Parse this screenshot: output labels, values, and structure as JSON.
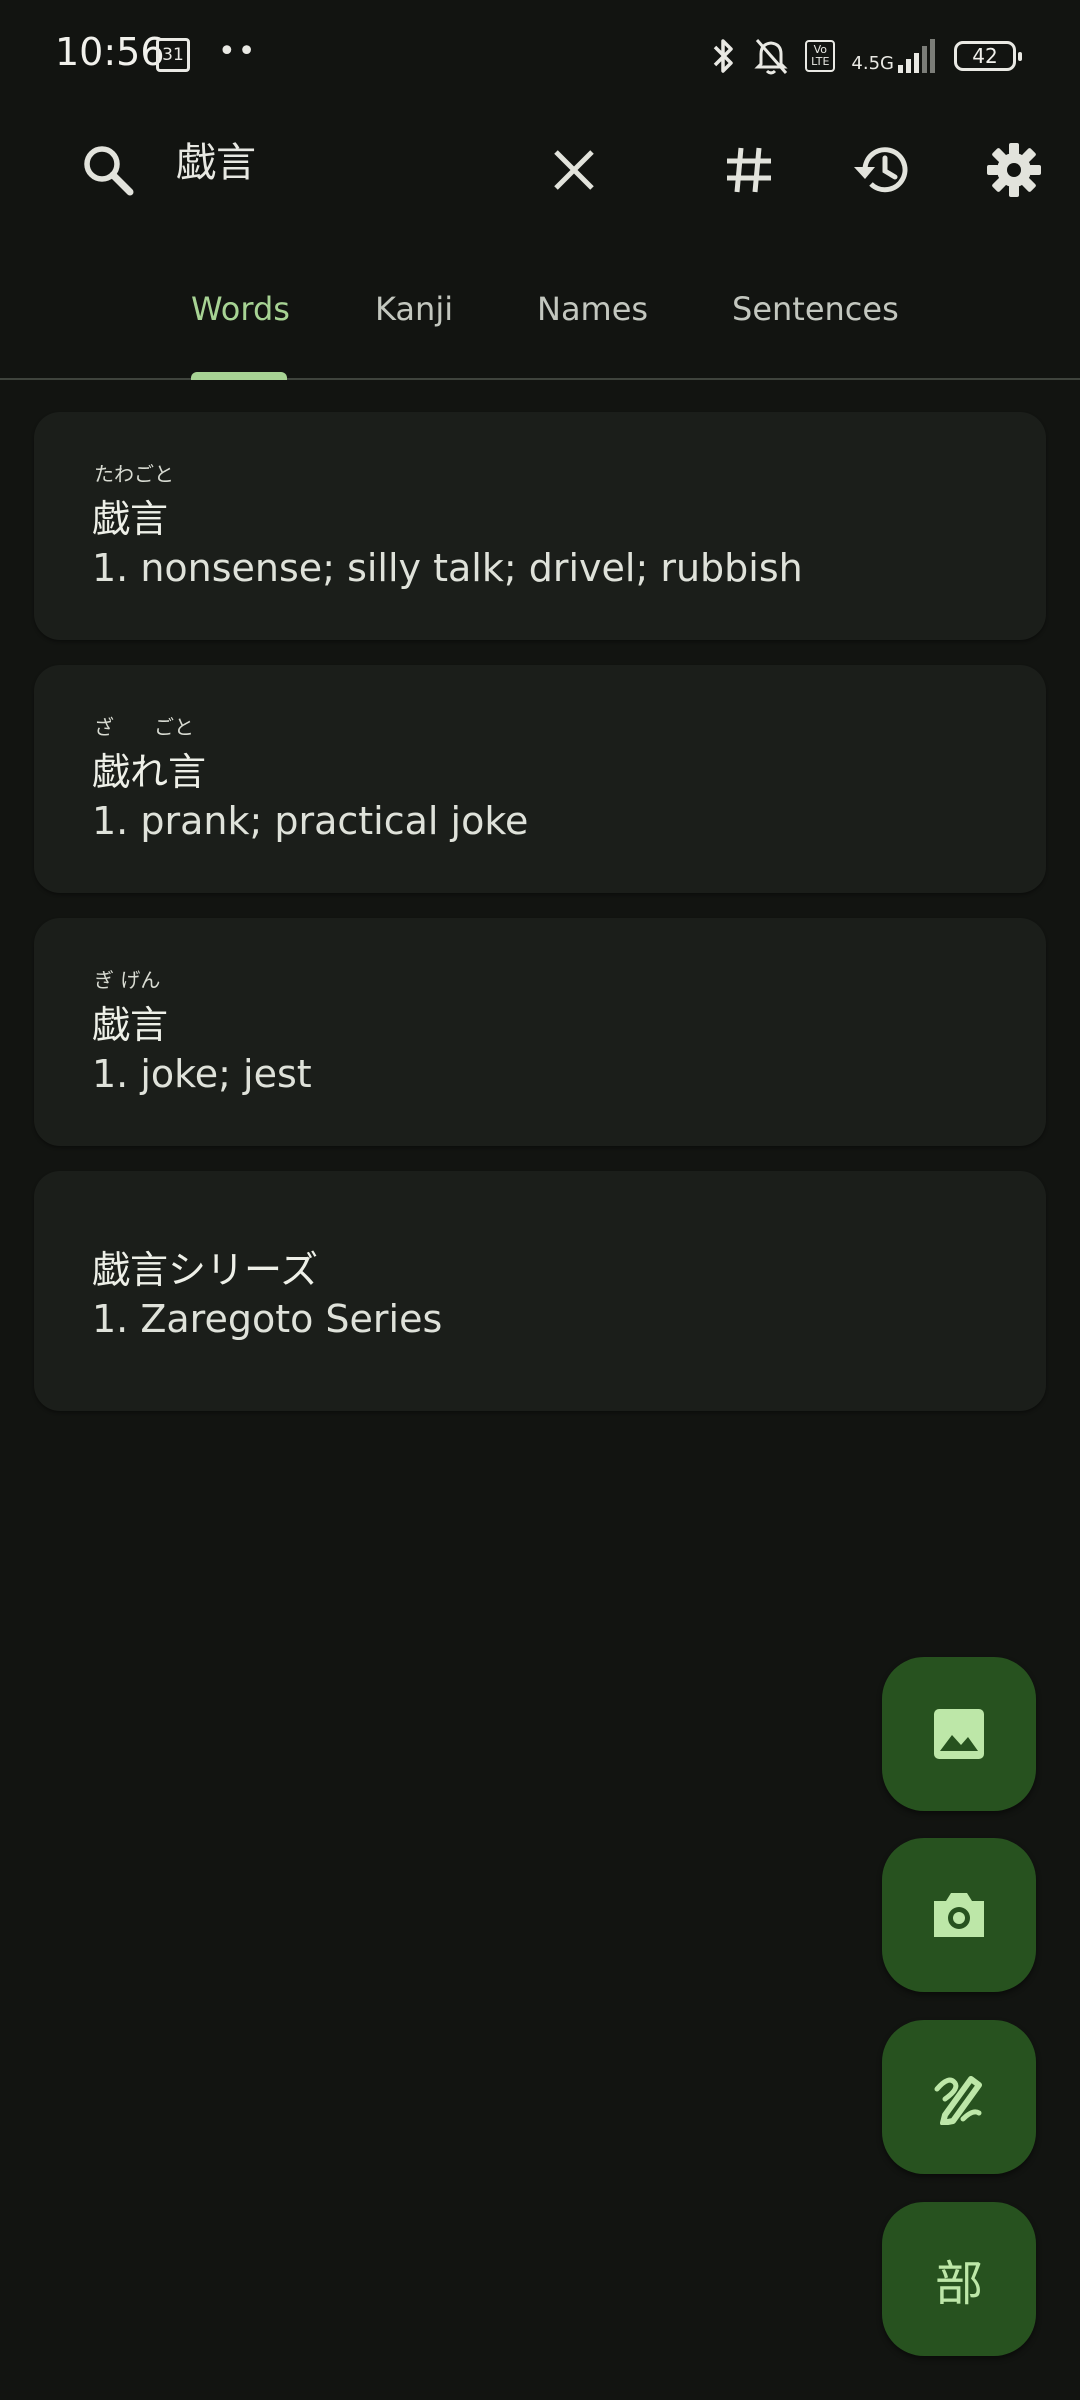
{
  "status_bar": {
    "time": "10:56",
    "calendar_day": "31",
    "dots": "••",
    "volte": "Vo\nLTE",
    "network": "4.5G",
    "battery": "42"
  },
  "search": {
    "query": "戯言"
  },
  "tabs": [
    {
      "label": "Words",
      "active": true
    },
    {
      "label": "Kanji",
      "active": false
    },
    {
      "label": "Names",
      "active": false
    },
    {
      "label": "Sentences",
      "active": false
    }
  ],
  "results": [
    {
      "furigana": "たわごと",
      "word": "戯言",
      "meaning": "1. nonsense; silly talk; drivel; rubbish"
    },
    {
      "furigana": "ざ　　ごと",
      "word": "戯れ言",
      "meaning": "1. prank; practical joke"
    },
    {
      "furigana": "ぎ げん",
      "word": "戯言",
      "meaning": "1. joke; jest"
    },
    {
      "furigana": "",
      "word": "戯言シリーズ",
      "meaning": "1. Zaregoto Series"
    }
  ],
  "fabs": {
    "radical_label": "部"
  },
  "colors": {
    "background": "#121411",
    "card": "#1b1e1a",
    "accent": "#a7d394",
    "fab": "#27521f"
  }
}
